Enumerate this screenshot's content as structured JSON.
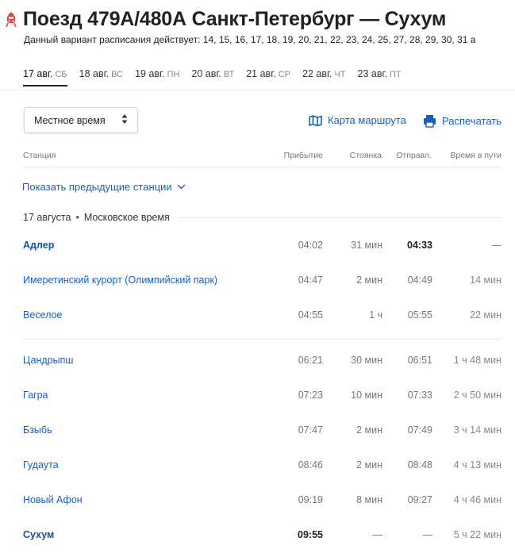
{
  "header": {
    "title": "Поезд 479А/480А Санкт-Петербург — Сухум",
    "schedule_note": "Данный вариант расписания действует: 14, 15, 16, 17, 18, 19, 20, 21, 22, 23, 24, 25, 27, 28, 29, 30, 31 а"
  },
  "tabs": [
    {
      "date": "17 авг.",
      "dow": "СБ",
      "active": true
    },
    {
      "date": "18 авг.",
      "dow": "ВС"
    },
    {
      "date": "19 авг.",
      "dow": "ПН"
    },
    {
      "date": "20 авг.",
      "dow": "ВТ"
    },
    {
      "date": "21 авг.",
      "dow": "СР"
    },
    {
      "date": "22 авг.",
      "dow": "ЧТ"
    },
    {
      "date": "23 авг.",
      "dow": "ПТ"
    }
  ],
  "controls": {
    "timezone_select": "Местное время",
    "map_link": "Карта маршрута",
    "print_link": "Распечатать"
  },
  "table": {
    "headers": {
      "station": "Станция",
      "arrival": "Прибытие",
      "stop": "Стоянка",
      "departure": "Отправл.",
      "travel": "Время в пути"
    },
    "show_previous": "Показать предыдущие станции",
    "date_label": "17 августа",
    "timezone_label": "Московское время",
    "rows": [
      {
        "station": "Адлер",
        "arrival": "04:02",
        "stop": "31 мин",
        "departure": "04:33",
        "travel": "—"
      },
      {
        "station": "Имеретинский курорт (Олимпийский парк)",
        "arrival": "04:47",
        "stop": "2 мин",
        "departure": "04:49",
        "travel": "14 мин"
      },
      {
        "station": "Веселое",
        "arrival": "04:55",
        "stop": "1 ч",
        "departure": "05:55",
        "travel": "22 мин"
      },
      {
        "station": "Цандрыпш",
        "arrival": "06:21",
        "stop": "30 мин",
        "departure": "06:51",
        "travel": "1 ч 48 мин"
      },
      {
        "station": "Гагра",
        "arrival": "07:23",
        "stop": "10 мин",
        "departure": "07:33",
        "travel": "2 ч 50 мин"
      },
      {
        "station": "Бзыбь",
        "arrival": "07:47",
        "stop": "2 мин",
        "departure": "07:49",
        "travel": "3 ч 14 мин"
      },
      {
        "station": "Гудаута",
        "arrival": "08:46",
        "stop": "2 мин",
        "departure": "08:48",
        "travel": "4 ч 13 мин"
      },
      {
        "station": "Новый Афон",
        "arrival": "09:19",
        "stop": "8 мин",
        "departure": "09:27",
        "travel": "4 ч 46 мин"
      },
      {
        "station": "Сухум",
        "arrival": "09:55",
        "stop": "—",
        "departure": "—",
        "travel": "5 ч 22 мин"
      }
    ]
  },
  "colors": {
    "link": "#1560bd",
    "train_icon": "#e8413b"
  },
  "icons": {
    "train": "train-icon",
    "sort": "sort-arrows-icon",
    "map": "map-icon",
    "print": "printer-icon",
    "chevron": "chevron-down-icon"
  }
}
